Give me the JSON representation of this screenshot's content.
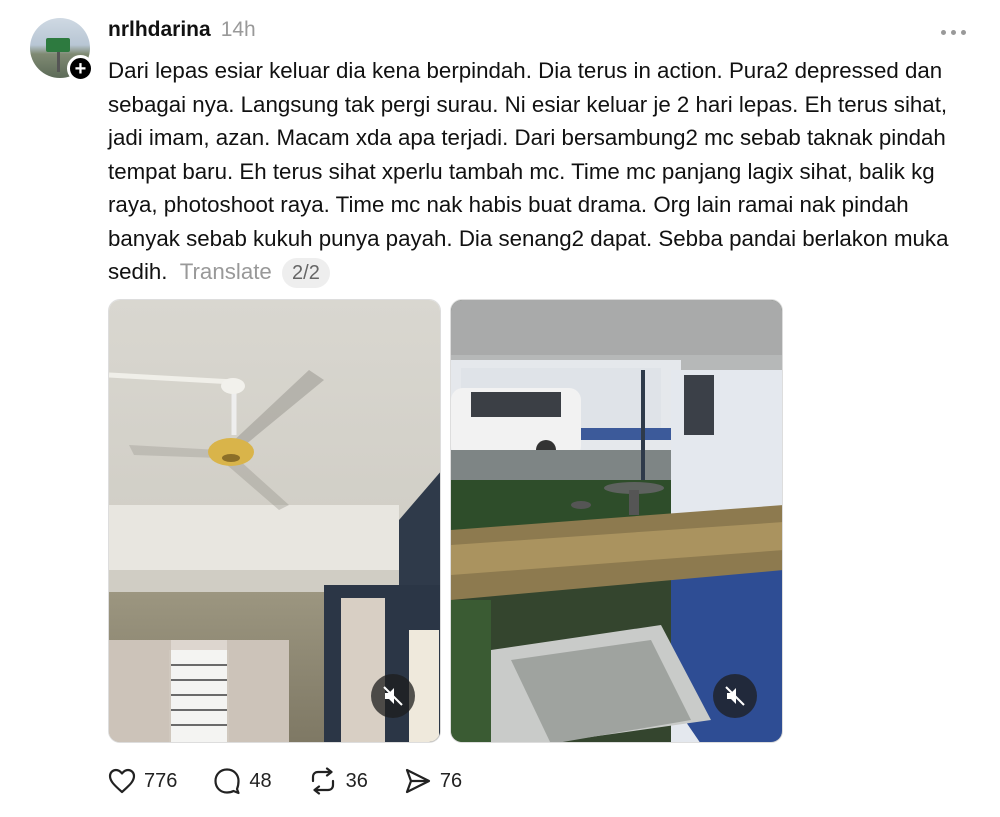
{
  "post": {
    "username": "nrlhdarina",
    "time": "14h",
    "text": "Dari lepas esiar keluar dia kena berpindah. Dia terus in action. Pura2 depressed dan sebagai nya. Langsung tak pergi surau. Ni esiar keluar je 2 hari lepas. Eh terus sihat, jadi imam, azan. Macam xda apa terjadi. Dari bersambung2 mc sebab taknak pindah tempat baru. Eh terus sihat xperlu tambah mc. Time mc panjang lagix sihat, balik kg raya, photoshoot raya. Time mc nak habis buat drama. Org lain ramai nak pindah banyak sebab kukuh punya payah. Dia senang2 dapat. Sebba pandai berlakon muka sedih.",
    "translate_label": "Translate",
    "page_indicator": "2/2"
  },
  "media": [
    {
      "icon": "muted-speaker-icon"
    },
    {
      "icon": "muted-speaker-icon"
    }
  ],
  "actions": {
    "likes": "776",
    "comments": "48",
    "reposts": "36",
    "shares": "76"
  },
  "icons": {
    "like": "heart-icon",
    "comment": "speech-bubble-icon",
    "repost": "repost-icon",
    "share": "send-icon",
    "more": "more-dots-icon",
    "follow": "plus-icon"
  }
}
